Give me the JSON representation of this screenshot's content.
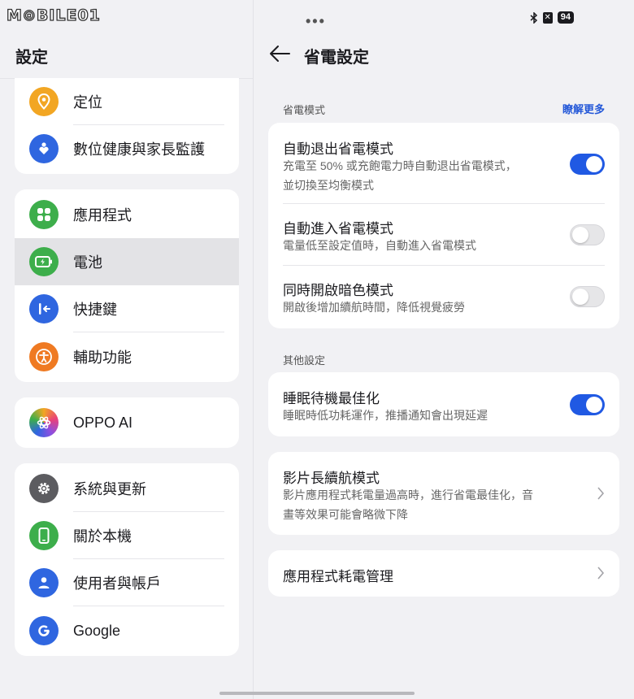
{
  "watermark": "M⊙BILE01",
  "left": {
    "title": "設定",
    "cards": [
      {
        "items": [
          {
            "label": "定位",
            "icon": "location-icon",
            "color": "#f2a623"
          },
          {
            "label": "數位健康與家長監護",
            "icon": "digital-wellbeing-icon",
            "color": "#2f66e0"
          }
        ]
      },
      {
        "items": [
          {
            "label": "應用程式",
            "icon": "apps-icon",
            "color": "#3dae4b"
          },
          {
            "label": "電池",
            "icon": "battery-icon",
            "color": "#3dae4b",
            "selected": true
          },
          {
            "label": "快捷鍵",
            "icon": "shortcut-icon",
            "color": "#2f66e0"
          },
          {
            "label": "輔助功能",
            "icon": "accessibility-icon",
            "color": "#ef7a22"
          }
        ]
      },
      {
        "items": [
          {
            "label": "OPPO AI",
            "icon": "oppo-ai-icon",
            "color": "#b04fd1"
          }
        ]
      },
      {
        "items": [
          {
            "label": "系統與更新",
            "icon": "gear-icon",
            "color": "#5c5c60"
          },
          {
            "label": "關於本機",
            "icon": "phone-icon",
            "color": "#3dae4b"
          },
          {
            "label": "使用者與帳戶",
            "icon": "user-icon",
            "color": "#2f66e0"
          },
          {
            "label": "Google",
            "icon": "google-icon",
            "color": "#2f66e0"
          }
        ]
      }
    ]
  },
  "status": {
    "dots": "•••",
    "battery": "94"
  },
  "right": {
    "title": "省電設定",
    "section1": {
      "label": "省電模式",
      "link": "瞭解更多"
    },
    "power_saving": [
      {
        "title": "自動退出省電模式",
        "subtitle_lines": [
          "充電至 50% 或充飽電力時自動退出省電模式，",
          "並切換至均衡模式"
        ],
        "on": true
      },
      {
        "title": "自動進入省電模式",
        "subtitle_lines": [
          "電量低至設定值時，自動進入省電模式"
        ],
        "on": false
      },
      {
        "title": "同時開啟暗色模式",
        "subtitle_lines": [
          "開啟後增加續航時間，降低視覺疲勞"
        ],
        "on": false
      }
    ],
    "section2": {
      "label": "其他設定"
    },
    "sleep": {
      "title": "睡眠待機最佳化",
      "subtitle": "睡眠時低功耗運作，推播通知會出現延遲",
      "on": true
    },
    "video": {
      "title": "影片長續航模式",
      "subtitle_lines": [
        "影片應用程式耗電量過高時，進行省電最佳化，音",
        "畫等效果可能會略微下降"
      ]
    },
    "app_power": {
      "title": "應用程式耗電管理"
    }
  },
  "colors": {
    "accent": "#2059e3",
    "link": "#2458d8"
  }
}
